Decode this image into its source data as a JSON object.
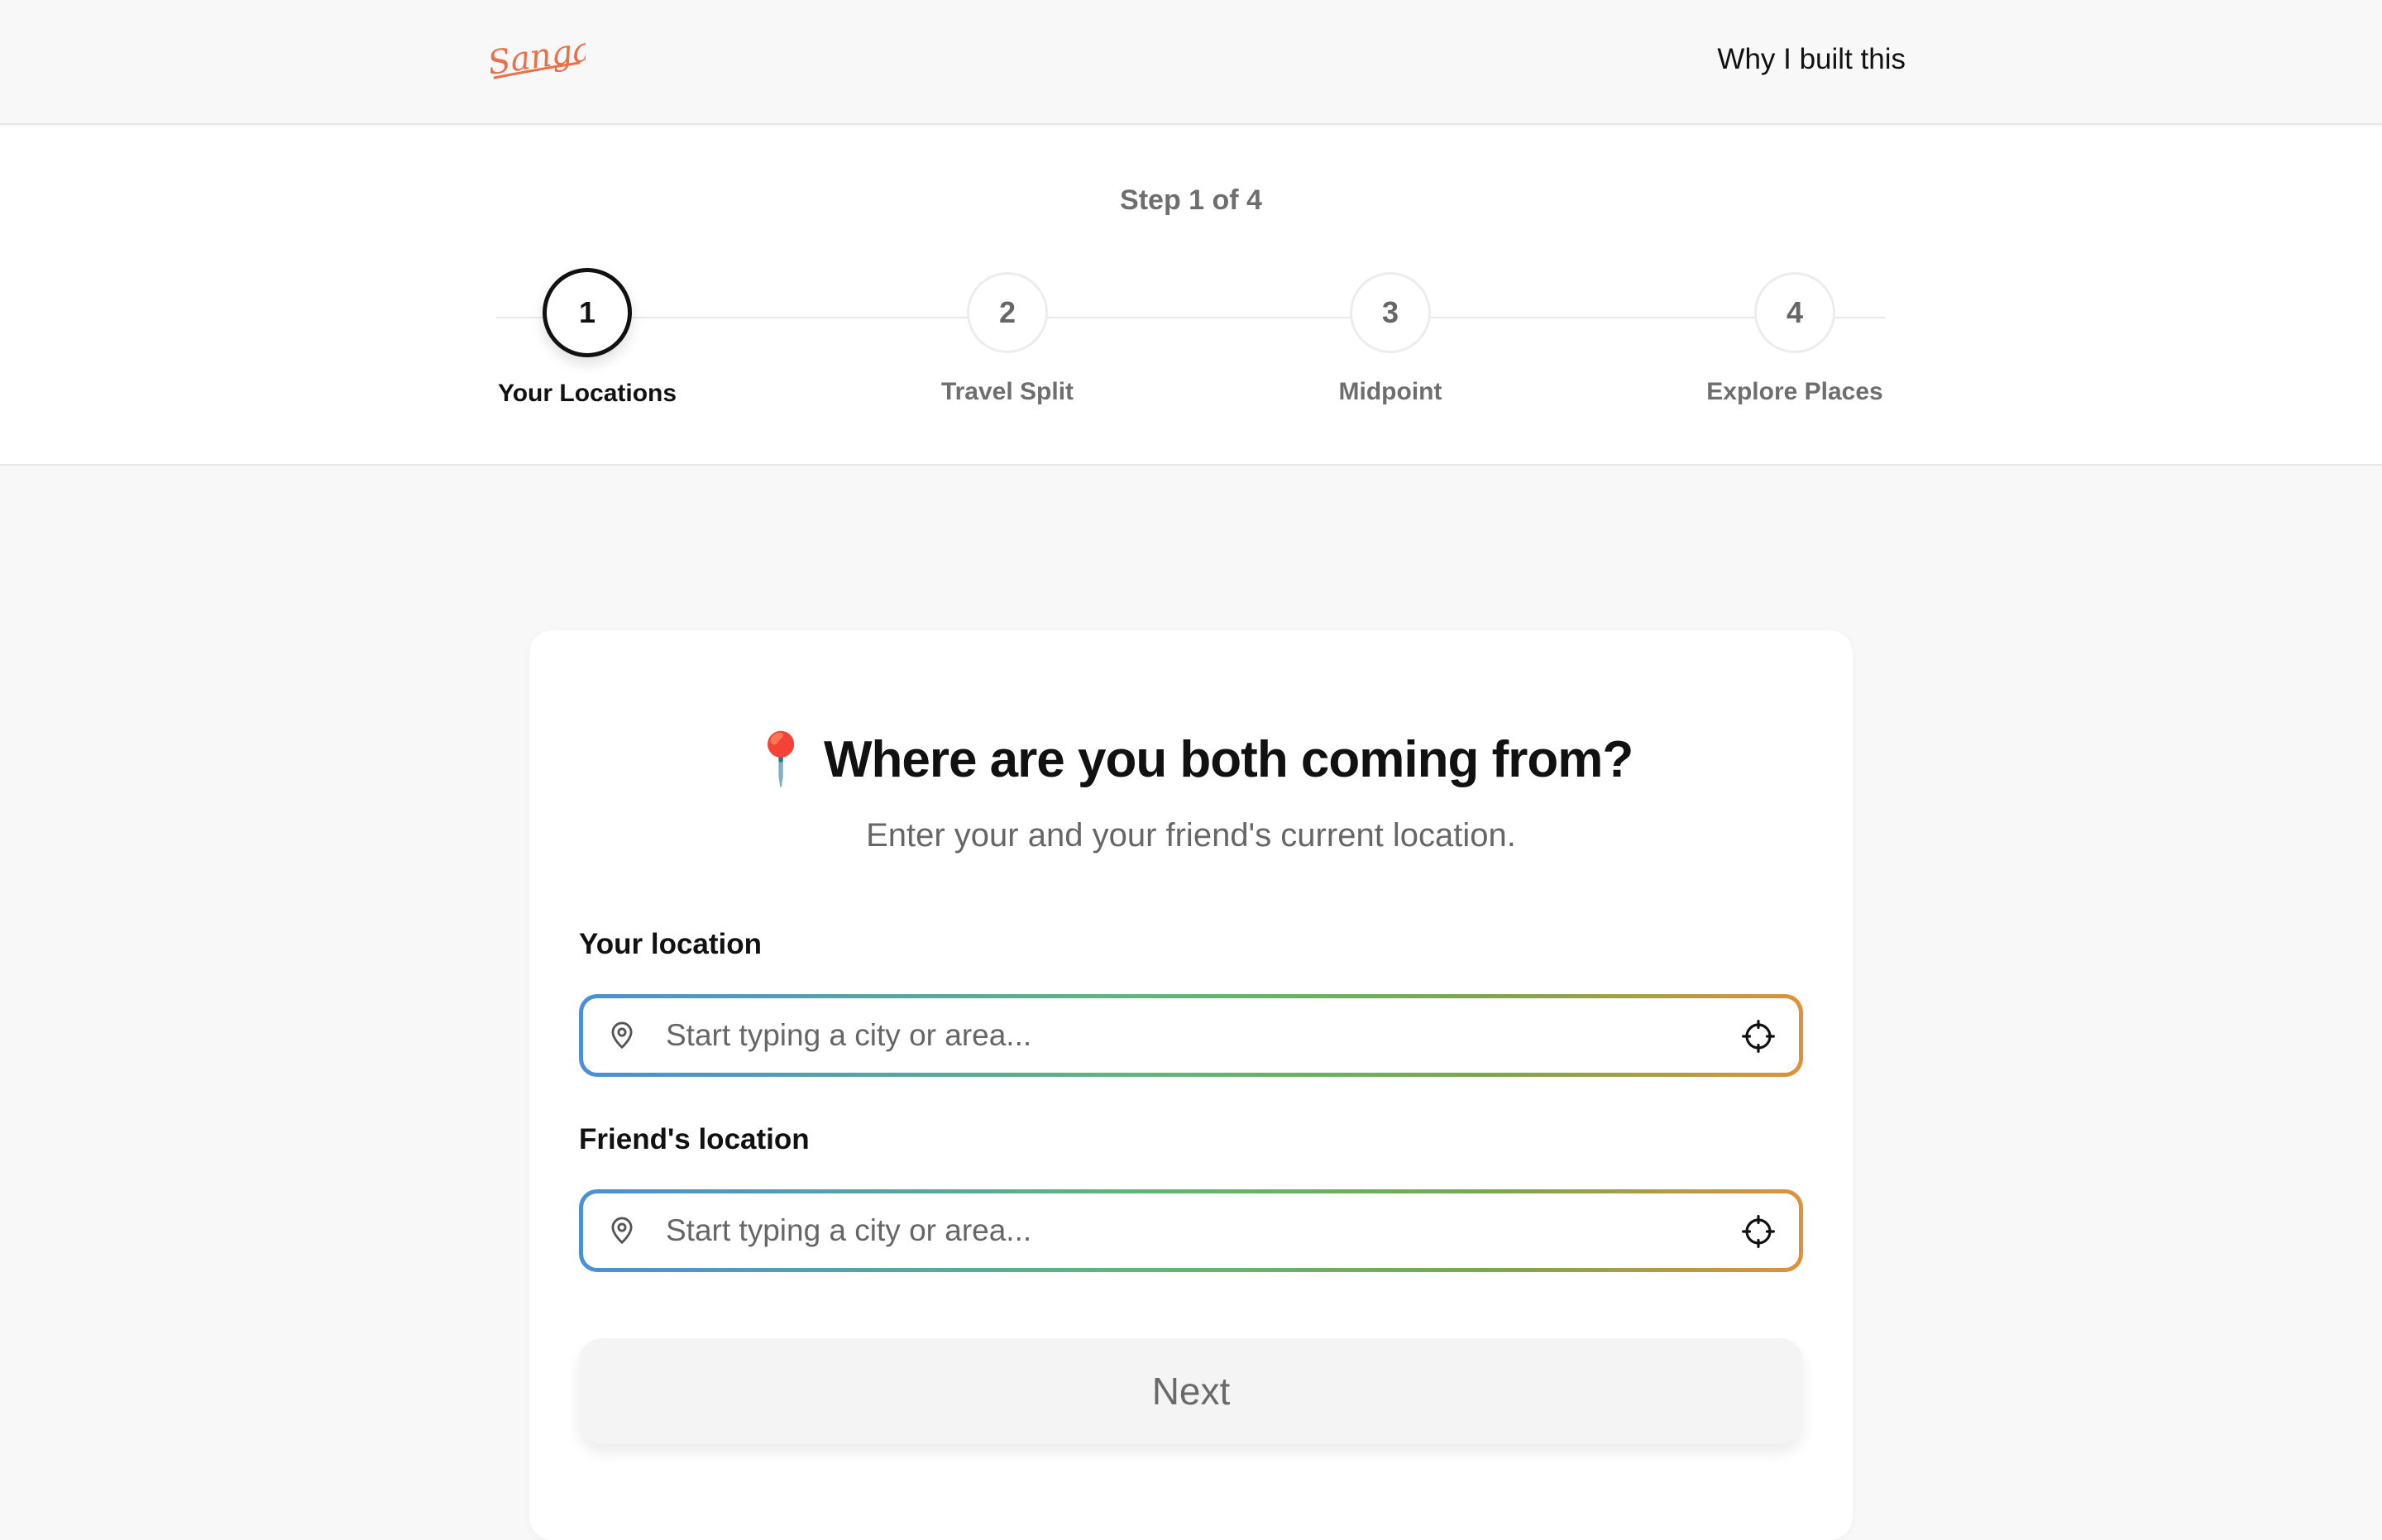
{
  "header": {
    "logo_text": "Sangam",
    "brand_color": "#e8714a",
    "nav_link": "Why I built this"
  },
  "stepper": {
    "progress_text": "Step 1 of 4",
    "steps": [
      {
        "number": "1",
        "label": "Your Locations",
        "active": true
      },
      {
        "number": "2",
        "label": "Travel Split",
        "active": false
      },
      {
        "number": "3",
        "label": "Midpoint",
        "active": false
      },
      {
        "number": "4",
        "label": "Explore Places",
        "active": false
      }
    ]
  },
  "card": {
    "title_emoji": "📍",
    "title": "Where are you both coming from?",
    "subtitle": "Enter your and your friend's current location.",
    "your_location": {
      "label": "Your location",
      "placeholder": "Start typing a city or area...",
      "value": ""
    },
    "friend_location": {
      "label": "Friend's location",
      "placeholder": "Start typing a city or area...",
      "value": ""
    },
    "next_label": "Next"
  },
  "icons": {
    "pin": "map-pin-icon",
    "locate": "crosshair-icon"
  }
}
